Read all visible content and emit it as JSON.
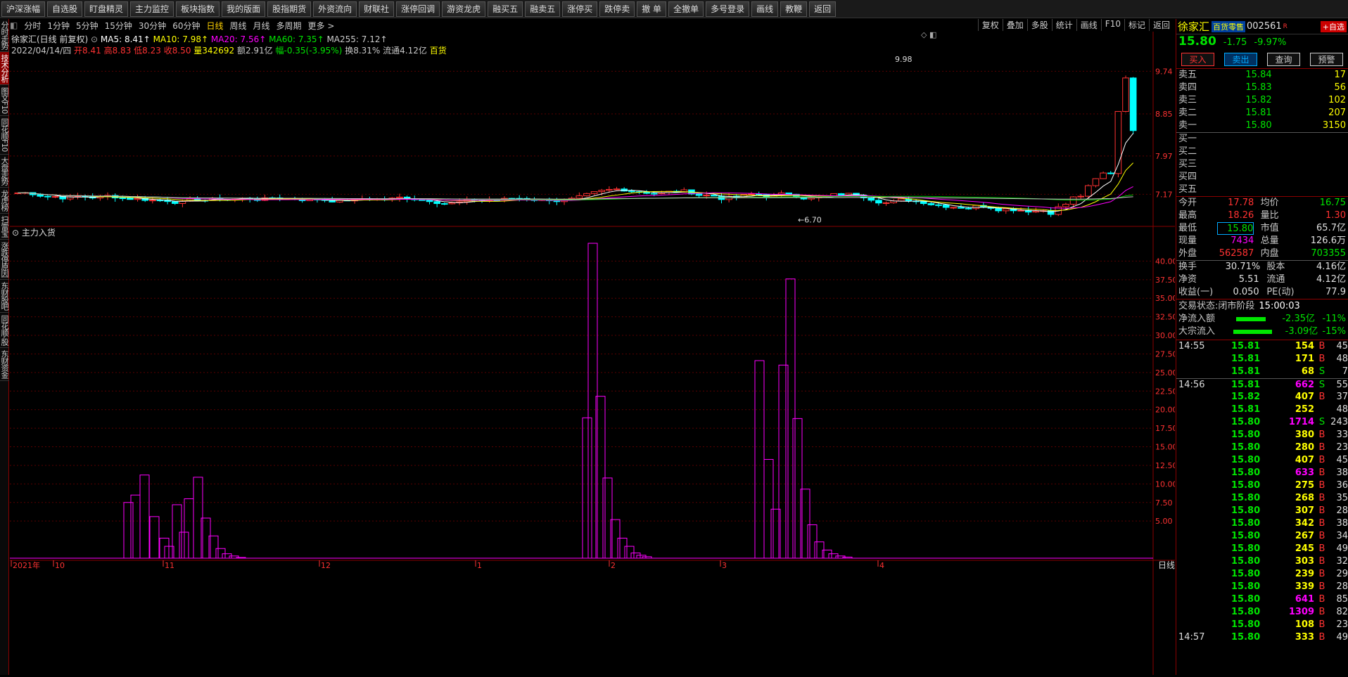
{
  "toolbar": [
    "沪深涨幅",
    "自选股",
    "盯盘精灵",
    "主力监控",
    "板块指数",
    "我的版面",
    "股指期货",
    "外资流向",
    "财联社",
    "涨停回调",
    "游资龙虎",
    "融买五",
    "融卖五",
    "涨停买",
    "跌停卖",
    "撤 单",
    "全撤单",
    "多号登录",
    "画线",
    "教鞭",
    "返回"
  ],
  "left_tabs": [
    "分时走势",
    "技术分析",
    "图文F10",
    "同花顺F10",
    "大盘走势",
    "龙虎榜",
    "扫雷宝",
    "涨跌停原因",
    "东财股吧",
    "同花顺-股",
    "东财资金"
  ],
  "periods": [
    "分时",
    "1分钟",
    "5分钟",
    "15分钟",
    "30分钟",
    "60分钟",
    "日线",
    "周线",
    "月线",
    "多周期",
    "更多 >"
  ],
  "chart_buttons": [
    "复权",
    "叠加",
    "多股",
    "统计",
    "画线",
    "F10",
    "标记",
    "返回"
  ],
  "info": {
    "name": "徐家汇(日线 前复权)",
    "ma5": "MA5: 8.41↑",
    "ma10": "MA10: 7.98↑",
    "ma20": "MA20: 7.56↑",
    "ma60": "MA60: 7.35↑",
    "ma255": "MA255: 7.12↑",
    "date": "2022/04/14/四",
    "open": "开8.41",
    "high": "高8.83",
    "low": "低8.23",
    "close": "收8.50",
    "vol": "量342692",
    "amt": "额2.91亿",
    "chg": "幅-0.35(-3.95%)",
    "turn": "换8.31%",
    "float": "流通4.12亿",
    "ind": "百货"
  },
  "price_axis": [
    "9.74",
    "8.85",
    "7.97",
    "7.17"
  ],
  "max_label": "9.98",
  "min_label": "6.70",
  "indicator_title": "主力入货",
  "ind_axis": [
    "40.00",
    "37.50",
    "35.00",
    "32.50",
    "30.00",
    "27.50",
    "25.00",
    "22.50",
    "20.00",
    "17.50",
    "15.00",
    "12.50",
    "10.00",
    "7.50",
    "5.00"
  ],
  "x_axis": [
    "2021年",
    "10",
    "11",
    "12",
    "1",
    "2",
    "3",
    "4"
  ],
  "axis_corner": "日线",
  "stock": {
    "name": "徐家汇",
    "sector": "百货零售",
    "code": "002561",
    "flag": "R",
    "add": "+自选",
    "price": "15.80",
    "change": "-1.75",
    "pct": "-9.97%",
    "buttons": [
      "买入",
      "卖出",
      "查询",
      "预警"
    ],
    "asks": [
      [
        "卖五",
        "15.84",
        "17"
      ],
      [
        "卖四",
        "15.83",
        "56"
      ],
      [
        "卖三",
        "15.82",
        "102"
      ],
      [
        "卖二",
        "15.81",
        "207"
      ],
      [
        "卖一",
        "15.80",
        "3150"
      ]
    ],
    "bids": [
      "买一",
      "买二",
      "买三",
      "买四",
      "买五"
    ],
    "stats": [
      [
        "今开",
        "17.78",
        "均价",
        "16.75"
      ],
      [
        "最高",
        "18.26",
        "量比",
        "1.30"
      ],
      [
        "最低",
        "15.80",
        "市值",
        "65.7亿"
      ],
      [
        "现量",
        "7434",
        "总量",
        "126.6万"
      ],
      [
        "外盘",
        "562587",
        "内盘",
        "703355"
      ]
    ],
    "stats2": [
      [
        "换手",
        "30.71%",
        "股本",
        "4.16亿"
      ],
      [
        "净资",
        "5.51",
        "流通",
        "4.12亿"
      ],
      [
        "收益(一)",
        "0.050",
        "PE(动)",
        "77.9"
      ]
    ],
    "status_label": "交易状态:",
    "status": "闭市阶段",
    "status_time": "15:00:03",
    "flow": [
      [
        "净流入额",
        "-2.35亿",
        "-11%"
      ],
      [
        "大宗流入",
        "-3.09亿",
        "-15%"
      ]
    ]
  },
  "ticks": [
    [
      "14:55",
      "15.81",
      "154",
      "B",
      "45"
    ],
    [
      "",
      "15.81",
      "171",
      "B",
      "48"
    ],
    [
      "",
      "15.81",
      "68",
      "S",
      "7"
    ],
    [
      "14:56",
      "15.81",
      "662",
      "S",
      "55"
    ],
    [
      "",
      "15.82",
      "407",
      "B",
      "37"
    ],
    [
      "",
      "15.81",
      "252",
      "",
      "48"
    ],
    [
      "",
      "15.80",
      "1714",
      "S",
      "243"
    ],
    [
      "",
      "15.80",
      "380",
      "B",
      "33"
    ],
    [
      "",
      "15.80",
      "280",
      "B",
      "23"
    ],
    [
      "",
      "15.80",
      "407",
      "B",
      "45"
    ],
    [
      "",
      "15.80",
      "633",
      "B",
      "38"
    ],
    [
      "",
      "15.80",
      "275",
      "B",
      "36"
    ],
    [
      "",
      "15.80",
      "268",
      "B",
      "35"
    ],
    [
      "",
      "15.80",
      "307",
      "B",
      "28"
    ],
    [
      "",
      "15.80",
      "342",
      "B",
      "38"
    ],
    [
      "",
      "15.80",
      "267",
      "B",
      "34"
    ],
    [
      "",
      "15.80",
      "245",
      "B",
      "49"
    ],
    [
      "",
      "15.80",
      "303",
      "B",
      "32"
    ],
    [
      "",
      "15.80",
      "239",
      "B",
      "29"
    ],
    [
      "",
      "15.80",
      "339",
      "B",
      "28"
    ],
    [
      "",
      "15.80",
      "641",
      "B",
      "85"
    ],
    [
      "",
      "15.80",
      "1309",
      "B",
      "82"
    ],
    [
      "",
      "15.80",
      "108",
      "B",
      "23"
    ],
    [
      "14:57",
      "15.80",
      "333",
      "B",
      "49"
    ]
  ],
  "colors": {
    "up": "#ff3232",
    "down": "#00ffff",
    "ma5": "#ffffff",
    "ma10": "#ffff00",
    "ma20": "#ff00ff",
    "ma60": "#00c800",
    "ma255": "#c8c8c8",
    "ind": "#ff00ff"
  }
}
